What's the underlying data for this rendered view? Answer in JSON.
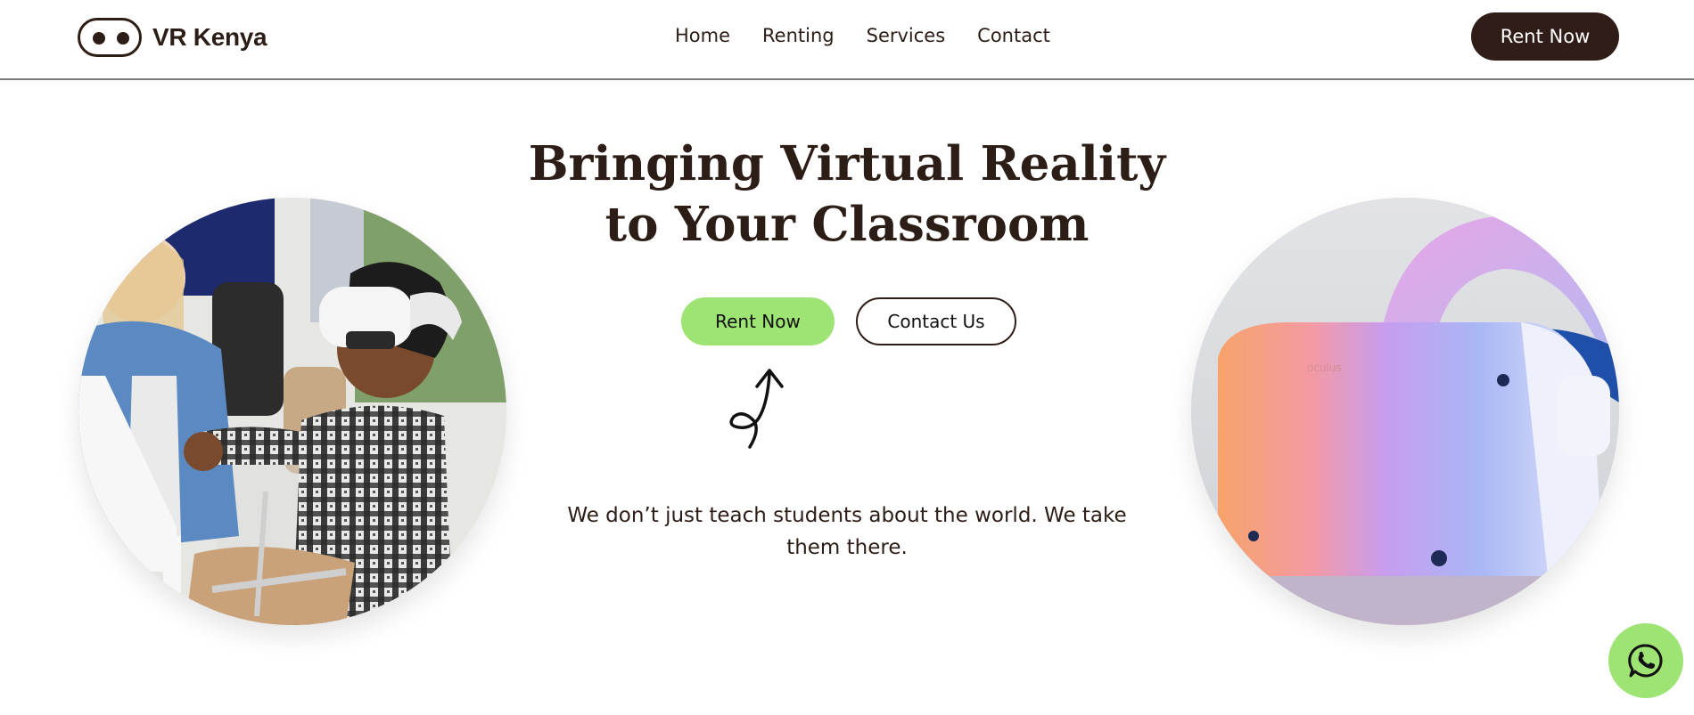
{
  "brand": {
    "name": "VR Kenya",
    "logo_icon": "vr-headset-eyes-icon"
  },
  "nav": {
    "items": [
      {
        "label": "Home"
      },
      {
        "label": "Renting"
      },
      {
        "label": "Services"
      },
      {
        "label": "Contact"
      }
    ]
  },
  "header": {
    "cta_label": "Rent Now"
  },
  "hero": {
    "title_line1": "Bringing Virtual Reality",
    "title_line2": "to Your Classroom",
    "primary_cta": "Rent Now",
    "secondary_cta": "Contact Us",
    "tagline": "We don’t just teach students about the world. We take them there.",
    "decoration_icon": "squiggly-arrow-icon"
  },
  "images": {
    "left": "students-using-vr-headset-photo",
    "right": "vr-headset-product-photo"
  },
  "fab": {
    "icon": "whatsapp-icon"
  },
  "colors": {
    "brand_dark": "#311d17",
    "accent_green": "#9ee474",
    "text": "#2d1d17",
    "background": "#ffffff"
  }
}
